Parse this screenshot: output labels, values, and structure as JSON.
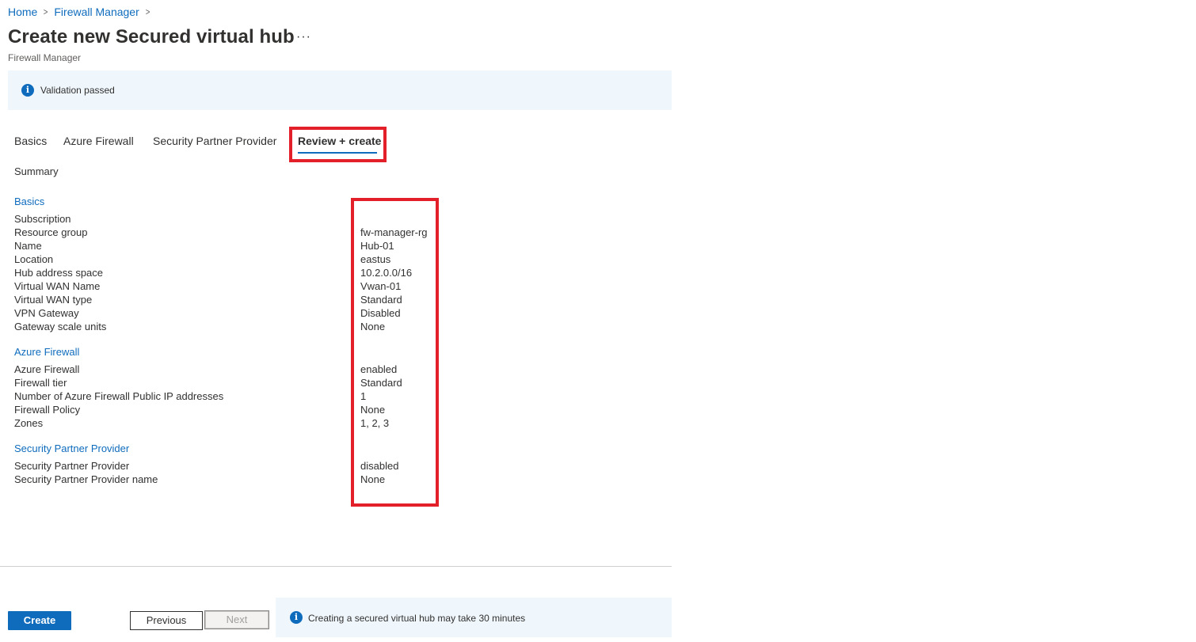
{
  "breadcrumb": {
    "home": "Home",
    "parent": "Firewall Manager",
    "separator": ">"
  },
  "header": {
    "title": "Create new Secured virtual hub",
    "more": "···",
    "subtitle": "Firewall Manager"
  },
  "validation_banner": {
    "text": "Validation passed",
    "icon": "info-icon"
  },
  "tabs": [
    {
      "label": "Basics",
      "active": false
    },
    {
      "label": "Azure Firewall",
      "active": false
    },
    {
      "label": "Security Partner Provider",
      "active": false
    },
    {
      "label": "Review + create",
      "active": true
    }
  ],
  "summary_label": "Summary",
  "sections": [
    {
      "heading": "Basics",
      "rows": [
        {
          "label": "Subscription",
          "value": ""
        },
        {
          "label": "Resource group",
          "value": "fw-manager-rg"
        },
        {
          "label": "Name",
          "value": "Hub-01"
        },
        {
          "label": "Location",
          "value": "eastus"
        },
        {
          "label": "Hub address space",
          "value": "10.2.0.0/16"
        },
        {
          "label": "Virtual WAN Name",
          "value": "Vwan-01"
        },
        {
          "label": "Virtual WAN type",
          "value": "Standard"
        },
        {
          "label": "VPN Gateway",
          "value": "Disabled"
        },
        {
          "label": "Gateway scale units",
          "value": "None"
        }
      ]
    },
    {
      "heading": "Azure Firewall",
      "rows": [
        {
          "label": "Azure Firewall",
          "value": "enabled"
        },
        {
          "label": "Firewall tier",
          "value": "Standard"
        },
        {
          "label": "Number of Azure Firewall Public IP addresses",
          "value": "1"
        },
        {
          "label": "Firewall Policy",
          "value": "None"
        },
        {
          "label": "Zones",
          "value": "1, 2, 3"
        }
      ]
    },
    {
      "heading": "Security Partner Provider",
      "rows": [
        {
          "label": "Security Partner Provider",
          "value": "disabled"
        },
        {
          "label": "Security Partner Provider name",
          "value": "None"
        }
      ]
    }
  ],
  "footer": {
    "create_label": "Create",
    "previous_label": "Previous",
    "next_label": "Next",
    "note_text": "Creating a secured virtual hub may take 30 minutes"
  },
  "colors": {
    "accent": "#0f6cbd",
    "highlight": "#e3202a",
    "banner_bg": "#eff6fc"
  }
}
